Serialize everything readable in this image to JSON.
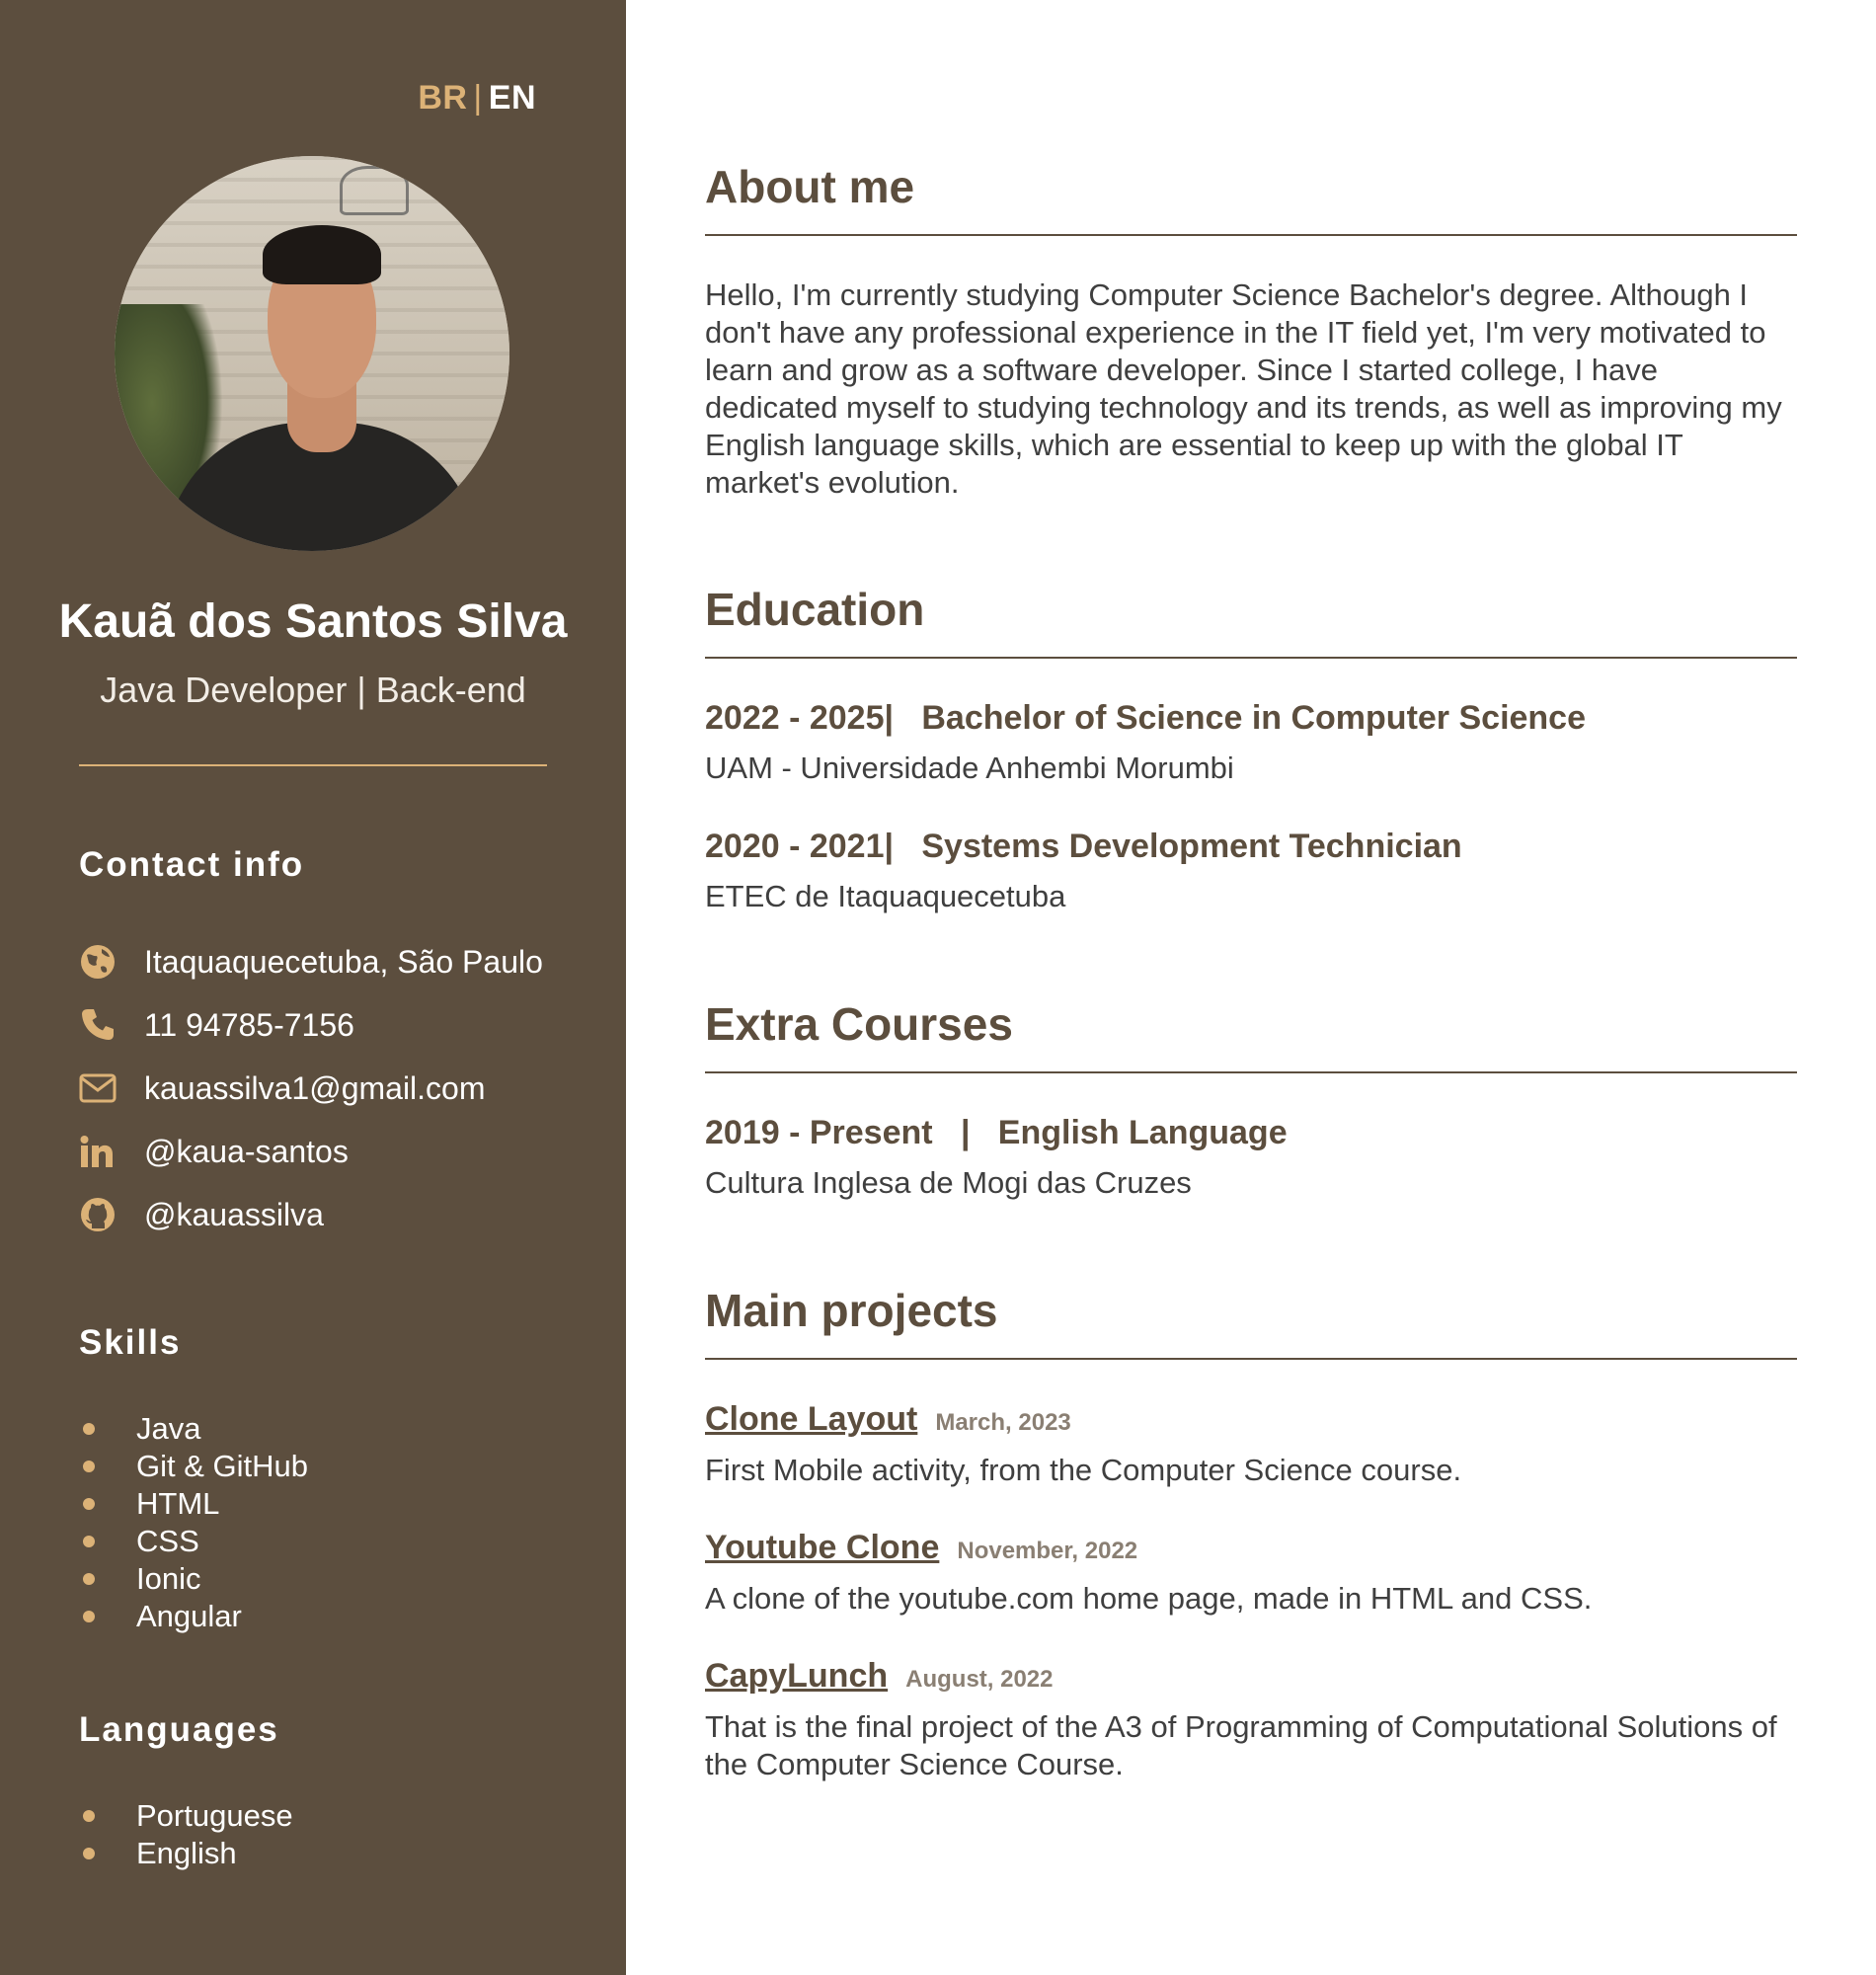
{
  "language_switch": {
    "br": "BR",
    "separator": "|",
    "en": "EN"
  },
  "profile": {
    "name": "Kauã dos Santos Silva",
    "role": "Java Developer | Back-end"
  },
  "contact": {
    "heading": "Contact info",
    "items": [
      {
        "icon": "globe-icon",
        "text": "Itaquaquecetuba, São Paulo"
      },
      {
        "icon": "phone-icon",
        "text": "11 94785-7156"
      },
      {
        "icon": "email-icon",
        "text": "kauassilva1@gmail.com"
      },
      {
        "icon": "linkedin-icon",
        "text": "@kaua-santos"
      },
      {
        "icon": "github-icon",
        "text": "@kauassilva"
      }
    ]
  },
  "skills": {
    "heading": "Skills",
    "items": [
      "Java",
      "Git & GitHub",
      "HTML",
      "CSS",
      "Ionic",
      "Angular"
    ]
  },
  "languages": {
    "heading": "Languages",
    "items": [
      "Portuguese",
      "English"
    ]
  },
  "about": {
    "title": "About me",
    "text": "Hello, I'm currently studying Computer Science Bachelor's degree. Although I don't have any professional experience in the IT field yet, I'm very motivated to learn and grow as a software developer. Since I started college, I have dedicated myself to studying technology and its trends, as well as improving my English language skills, which are essential to keep up with the global IT market's evolution."
  },
  "education": {
    "title": "Education",
    "items": [
      {
        "period": "2022 - 2025|",
        "degree": "Bachelor of Science in Computer Science",
        "school": "UAM - Universidade Anhembi Morumbi"
      },
      {
        "period": "2020 - 2021|",
        "degree": "Systems Development Technician",
        "school": "ETEC de Itaquaquecetuba"
      }
    ]
  },
  "extra_courses": {
    "title": "Extra Courses",
    "items": [
      {
        "period": "2019 - Present",
        "separator": "|",
        "course": "English Language",
        "school": "Cultura Inglesa de Mogi das Cruzes"
      }
    ]
  },
  "projects": {
    "title": "Main projects",
    "items": [
      {
        "name": "Clone Layout",
        "date": "March, 2023",
        "description": "First Mobile activity, from the Computer Science course."
      },
      {
        "name": "Youtube Clone",
        "date": "November, 2022",
        "description": "A clone of the youtube.com home page, made in HTML and CSS."
      },
      {
        "name": "CapyLunch",
        "date": "August, 2022",
        "description": "That is the final project of the A3 of Programming of Computational Solutions of the Computer Science Course."
      }
    ]
  },
  "colors": {
    "sidebar_bg": "#5c4e3e",
    "accent": "#dcb277",
    "text_dark": "#5c4e3e",
    "body_text": "#3f3f3f"
  }
}
